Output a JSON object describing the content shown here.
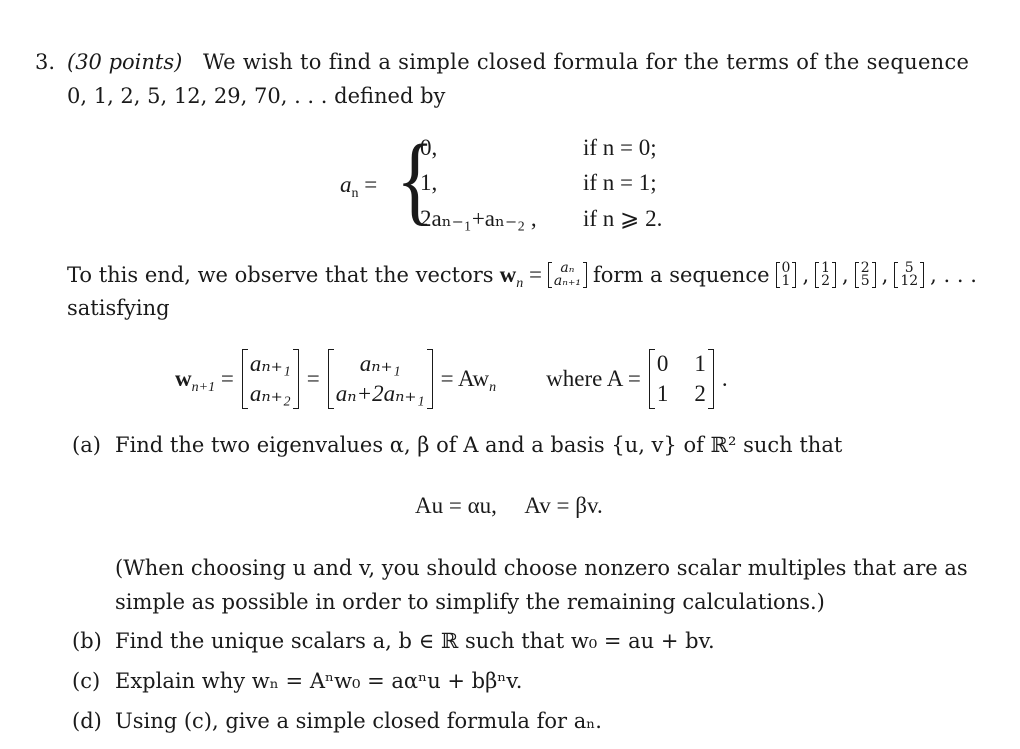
{
  "problem": {
    "number": "3.",
    "points": "(30 points)",
    "intro_line1": "We wish to find a simple closed formula for the terms of the sequence",
    "sequence": "0, 1, 2, 5, 12, 29, 70, . . .",
    "intro_line2_tail": "defined by"
  },
  "recurrence": {
    "lhs": "a",
    "lhs_sub": "n",
    "cases": [
      {
        "value": "0,",
        "condition": "if n = 0;"
      },
      {
        "value": "1,",
        "condition": "if n = 1;"
      },
      {
        "value": "2aₙ₋₁+aₙ₋₂ ,",
        "condition": "if n ⩾ 2."
      }
    ]
  },
  "vectors_text": {
    "prefix": "To this end, we observe that the vectors",
    "w": "w",
    "w_sub": "n",
    "vec_top": "aₙ",
    "vec_bottom": "aₙ₊₁",
    "middle": "form a sequence",
    "sequence_vectors": [
      {
        "top": "0",
        "bottom": "1"
      },
      {
        "top": "1",
        "bottom": "2"
      },
      {
        "top": "2",
        "bottom": "5"
      },
      {
        "top": "5",
        "bottom": "12"
      }
    ],
    "ellipsis": ", . . .",
    "line2": "satisfying"
  },
  "matrix_equation": {
    "lhs_w": "w",
    "lhs_sub": "n+1",
    "vec1_top": "aₙ₊₁",
    "vec1_bottom": "aₙ₊₂",
    "vec2_top": "aₙ₊₁",
    "vec2_bottom": "aₙ+2aₙ₊₁",
    "rhs": "= Aw",
    "rhs_sub": "n",
    "where_text": "where A =",
    "A": [
      [
        "0",
        "1"
      ],
      [
        "1",
        "2"
      ]
    ],
    "end": "."
  },
  "parts": {
    "a": {
      "label": "(a)",
      "text": "Find the two eigenvalues α, β of A and a basis {u, v} of ℝ² such that",
      "equation": "Au = αu,     Av = βv.",
      "note_line1": "(When choosing u and v, you should choose nonzero scalar multiples that are as",
      "note_line2": "simple as possible in order to simplify the remaining calculations.)"
    },
    "b": {
      "label": "(b)",
      "text": "Find the unique scalars a, b ∈ ℝ such that w₀ = au + bv."
    },
    "c": {
      "label": "(c)",
      "text": "Explain why wₙ = Aⁿw₀ = aαⁿu + bβⁿv."
    },
    "d": {
      "label": "(d)",
      "text": "Using (c), give a simple closed formula for aₙ."
    }
  }
}
